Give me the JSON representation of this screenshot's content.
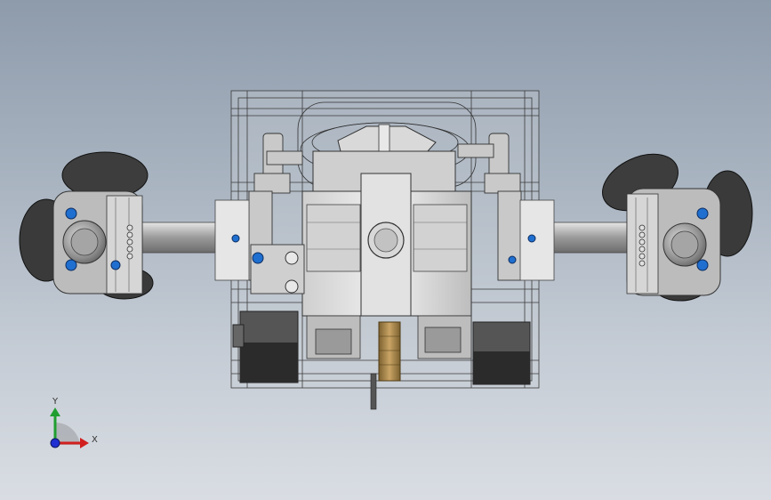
{
  "viewport": {
    "background_top": "#8e9bab",
    "background_bottom": "#d9dde3"
  },
  "triad": {
    "x_label": "X",
    "y_label": "Y",
    "x_color": "#d11f1f",
    "y_color": "#1f9e2f",
    "z_color": "#1f2fd1"
  },
  "model": {
    "name_icon": "robot-assembly-icon",
    "propeller_color": "#3a3a3a",
    "housing_color": "#c8c8c8",
    "bolt_color": "#1f6fd0",
    "brass_color": "#a8874a"
  }
}
